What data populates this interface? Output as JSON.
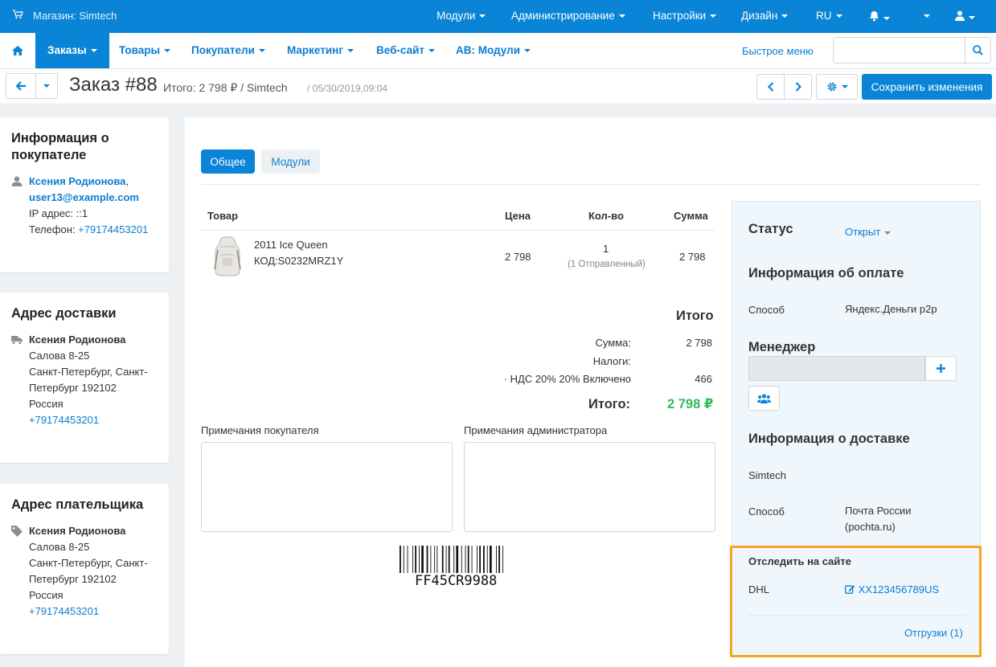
{
  "topbar": {
    "store": "Магазин: Simtech",
    "nav": [
      "Модули",
      "Администрирование",
      "Настройки",
      "Дизайн",
      "RU"
    ]
  },
  "navbar": {
    "items": [
      "Заказы",
      "Товары",
      "Покупатели",
      "Маркетинг",
      "Веб-сайт",
      "AB: Модули"
    ],
    "quick_menu": "Быстрое меню",
    "search_placeholder": ""
  },
  "titlebar": {
    "title": "Заказ #88",
    "subtitle": "Итого: 2 798 ₽ / Simtech",
    "date": "/ 05/30/2019,09:04",
    "save": "Сохранить изменения"
  },
  "customer": {
    "heading": "Информация о покупателе",
    "name": "Ксения Родионова",
    "email": "user13@example.com",
    "ip": "IP адрес: ::1",
    "phone_label": "Телефон:",
    "phone": "+79174453201"
  },
  "shipping_address": {
    "heading": "Адрес доставки",
    "name": "Ксения Родионова",
    "street": "Салова 8-25",
    "city": "Санкт-Петербург, Санкт-Петербург 192102",
    "country": "Россия",
    "phone": "+79174453201"
  },
  "billing_address": {
    "heading": "Адрес плательщика",
    "name": "Ксения Родионова",
    "street": "Салова 8-25",
    "city": "Санкт-Петербург, Санкт-Петербург 192102",
    "country": "Россия",
    "phone": "+79174453201"
  },
  "tabs": [
    "Общее",
    "Модули"
  ],
  "table": {
    "headers": [
      "Товар",
      "Цена",
      "Кол-во",
      "Сумма"
    ],
    "rows": [
      {
        "name": "2011 Ice Queen",
        "code": "КОД:S0232MRZ1Y",
        "price": "2 798",
        "qty": "1",
        "qty_note": "(1 Отправленный)",
        "total": "2 798"
      }
    ]
  },
  "totals": {
    "heading": "Итого",
    "subtotal_label": "Сумма:",
    "subtotal": "2 798",
    "taxes_label": "Налоги:",
    "vat_label": "· НДС 20% 20% Включено",
    "vat": "466",
    "grand_label": "Итого:",
    "grand": "2 798 ₽"
  },
  "notes": {
    "customer_label": "Примечания покупателя",
    "admin_label": "Примечания администратора"
  },
  "barcode": "FF45CR9988",
  "side": {
    "status_label": "Статус",
    "status_value": "Открыт",
    "payment_heading": "Информация об оплате",
    "payment_method_label": "Способ",
    "payment_method": "Яндекс.Деньги p2p",
    "manager_heading": "Менеджер",
    "shipping_heading": "Информация о доставке",
    "shipping_vendor": "Simtech",
    "shipping_method_label": "Способ",
    "shipping_method": "Почта России (pochta.ru)",
    "track_heading": "Отследить на сайте",
    "carrier": "DHL",
    "tracking": "XX123456789US",
    "shipments": "Отгрузки (1)"
  },
  "colors": {
    "primary": "#0a84d6",
    "success": "#2ebd59",
    "highlight": "#f5a623"
  }
}
